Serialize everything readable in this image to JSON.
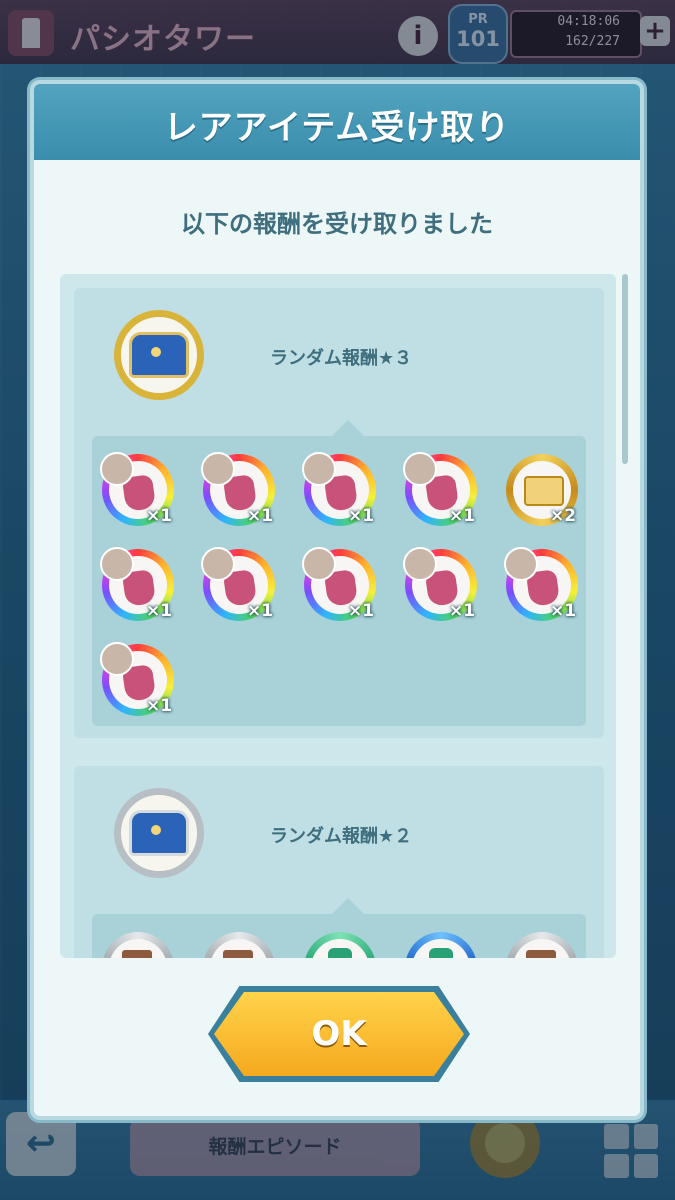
{
  "header": {
    "title": "パシオタワー",
    "info_label": "i",
    "pr_label": "PR",
    "pr_value": "101",
    "stamina_time": "04:18:06",
    "stamina_count": "162/227",
    "plus_label": "+"
  },
  "modal": {
    "title": "レアアイテム受け取り",
    "subtitle": "以下の報酬を受け取りました",
    "ok_label": "OK"
  },
  "sections": [
    {
      "label": "ランダム報酬★３",
      "chest": "gold-chest-icon",
      "items": [
        {
          "icon": "glove-item-icon",
          "qty": "×1"
        },
        {
          "icon": "glove-item-icon",
          "qty": "×1"
        },
        {
          "icon": "glove-item-icon",
          "qty": "×1"
        },
        {
          "icon": "glove-item-icon",
          "qty": "×1"
        },
        {
          "icon": "ticket-item-icon",
          "qty": "×2"
        },
        {
          "icon": "glove-item-icon",
          "qty": "×1"
        },
        {
          "icon": "glove-item-icon",
          "qty": "×1"
        },
        {
          "icon": "glove-item-icon",
          "qty": "×1"
        },
        {
          "icon": "glove-item-icon",
          "qty": "×1"
        },
        {
          "icon": "glove-item-icon",
          "qty": "×1"
        },
        {
          "icon": "glove-item-icon",
          "qty": "×1"
        }
      ]
    },
    {
      "label": "ランダム報酬★２",
      "chest": "silver-chest-icon",
      "items": [
        {
          "icon": "book-item-icon"
        },
        {
          "icon": "book-item-icon"
        },
        {
          "icon": "can-item-icon"
        },
        {
          "icon": "can-item-icon"
        },
        {
          "icon": "book-item-icon"
        }
      ]
    }
  ],
  "footer": {
    "back_label": "↩",
    "episode_label": "報酬エピソード"
  }
}
